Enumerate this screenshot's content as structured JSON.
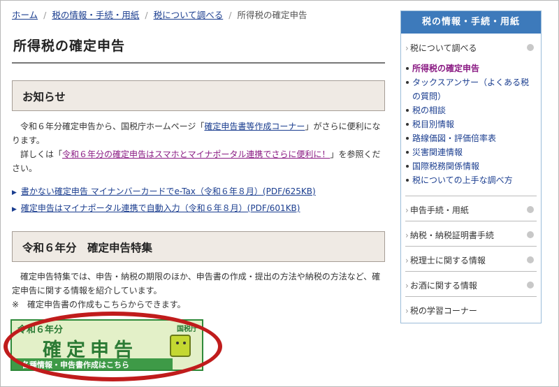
{
  "breadcrumb": {
    "home": "ホーム",
    "item2": "税の情報・手続・用紙",
    "item3": "税について調べる",
    "current": "所得税の確定申告",
    "separator": "/"
  },
  "page_title": "所得税の確定申告",
  "notice": {
    "heading": "お知らせ",
    "p1_pre": "令和６年分確定申告から、国税庁ホームページ「",
    "p1_link": "確定申告書等作成コーナー",
    "p1_post": "」がさらに便利になります。",
    "p2_pre": "詳しくは「",
    "p2_link": "令和６年分の確定申告はスマホとマイナポータル連携でさらに便利に！",
    "p2_post": "」を参照ください。",
    "links": [
      "書かない確定申告 マイナンバーカードでe-Tax（令和６年８月）(PDF/625KB)",
      "確定申告はマイナポータル連携で自動入力（令和６年８月）(PDF/601KB)"
    ]
  },
  "feature": {
    "heading": "令和６年分　確定申告特集",
    "p1": "確定申告特集では、申告・納税の期限のほか、申告書の作成・提出の方法や納税の方法など、確定申告に関する情報を紹介しています。",
    "p2": "※　確定申告書の作成もこちらからできます。",
    "banner": {
      "year": "令和６年分",
      "title": "確定申告",
      "strip": "各種情報・申告書作成はこちら",
      "agency": "国税庁"
    }
  },
  "sidebar": {
    "heading": "税の情報・手続・用紙",
    "section_tax": "税について調べる",
    "prefix": "›",
    "sub_items": [
      "所得税の確定申告",
      "タックスアンサー（よくある税の質問）",
      "税の相談",
      "税目別情報",
      "路線価図・評価倍率表",
      "災害関連情報",
      "国際税務関係情報",
      "税についての上手な調べ方"
    ],
    "sections": [
      "申告手続・用紙",
      "納税・納税証明書手続",
      "税理士に関する情報",
      "お酒に関する情報",
      "税の学習コーナー"
    ]
  },
  "colors": {
    "link": "#1a3d8f",
    "visited_link": "#8a1a83",
    "sidebar_header": "#3d7abb",
    "section_bg": "#efeae4",
    "highlight": "#c01c1c",
    "banner_green": "#2b7a34"
  }
}
